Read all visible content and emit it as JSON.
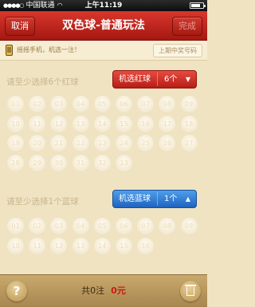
{
  "status_bar": {
    "carrier": "中国联通",
    "time": "上午11:19",
    "battery_level": 0.75
  },
  "navbar": {
    "cancel_label": "取消",
    "title": "双色球-普通玩法",
    "done_label": "完成"
  },
  "shake_bar": {
    "hint": "摇摇手机，机选一注！",
    "last_draw_label": "上期中奖号码"
  },
  "red_section": {
    "label": "请至少选择6个红球",
    "pick_label": "机选红球",
    "pick_count": "6个",
    "balls": [
      "01",
      "02",
      "03",
      "04",
      "05",
      "06",
      "07",
      "08",
      "09",
      "10",
      "11",
      "12",
      "13",
      "14",
      "15",
      "16",
      "17",
      "18",
      "19",
      "20",
      "21",
      "22",
      "23",
      "24",
      "25",
      "26",
      "27",
      "28",
      "29",
      "30",
      "31",
      "32",
      "33"
    ]
  },
  "blue_section": {
    "label": "请至少选择1个蓝球",
    "pick_label": "机选蓝球",
    "pick_count": "1个",
    "balls": [
      "01",
      "02",
      "03",
      "04",
      "05",
      "06",
      "07",
      "08",
      "09",
      "10",
      "11",
      "12",
      "13",
      "14",
      "15",
      "16"
    ]
  },
  "bottom_bar": {
    "help_label": "?",
    "count_text": "共0注",
    "amount_text": "0元"
  },
  "colors": {
    "red_accent": "#c81a12",
    "blue_accent": "#1f63c0",
    "background": "#efe3c2"
  }
}
